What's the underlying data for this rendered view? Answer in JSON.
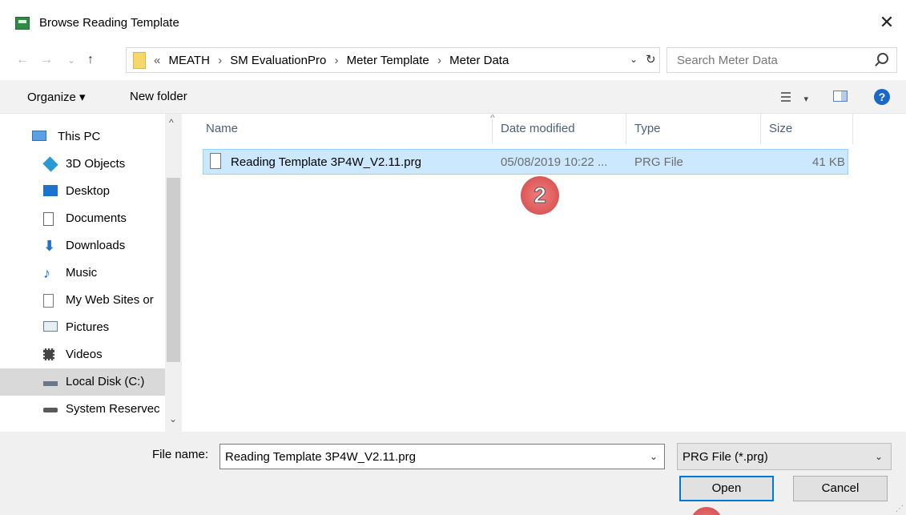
{
  "window": {
    "title": "Browse Reading Template",
    "close_glyph": "✕"
  },
  "nav_buttons": {
    "back": "←",
    "forward": "→",
    "recent": "⌄",
    "up": "↑"
  },
  "address": {
    "prefix": "«",
    "crumbs": [
      "MEATH",
      "SM EvaluationPro",
      "Meter Template",
      "Meter Data"
    ],
    "separator": "›",
    "dropdown_glyph": "⌄",
    "refresh_glyph": "↻"
  },
  "search": {
    "placeholder": "Search Meter Data"
  },
  "toolbar": {
    "organize": "Organize ▾",
    "new_folder": "New folder",
    "view_caret": "▾",
    "help": "?"
  },
  "nav_pane": {
    "items": [
      {
        "label": "This PC",
        "icon": "computer-icon"
      },
      {
        "label": "3D Objects",
        "icon": "cube-icon"
      },
      {
        "label": "Desktop",
        "icon": "desktop-icon"
      },
      {
        "label": "Documents",
        "icon": "documents-icon"
      },
      {
        "label": "Downloads",
        "icon": "download-arrow-icon"
      },
      {
        "label": "Music",
        "icon": "music-note-icon"
      },
      {
        "label": "My Web Sites or",
        "icon": "page-icon"
      },
      {
        "label": "Pictures",
        "icon": "pictures-icon"
      },
      {
        "label": "Videos",
        "icon": "film-icon"
      },
      {
        "label": "Local Disk (C:)",
        "icon": "drive-icon"
      },
      {
        "label": "System Reservec",
        "icon": "drive-icon"
      }
    ],
    "scroll_up": "^",
    "scroll_down": "⌄"
  },
  "columns": {
    "name": "Name",
    "date": "Date modified",
    "type": "Type",
    "size": "Size",
    "sort_caret": "^"
  },
  "files": [
    {
      "name": "Reading Template 3P4W_V2.11.prg",
      "date": "05/08/2019 10:22 ...",
      "type": "PRG File",
      "size": "41 KB"
    }
  ],
  "markers": {
    "step2": "2"
  },
  "bottom": {
    "file_name_label": "File name:",
    "file_name_value": "Reading Template 3P4W_V2.11.prg",
    "file_type_value": "PRG File (*.prg)",
    "dropdown_glyph": "⌄",
    "open": "Open",
    "cancel": "Cancel"
  },
  "colors": {
    "selection": "#cce8ff",
    "accent": "#0078d7",
    "marker": "#d53a3a"
  }
}
